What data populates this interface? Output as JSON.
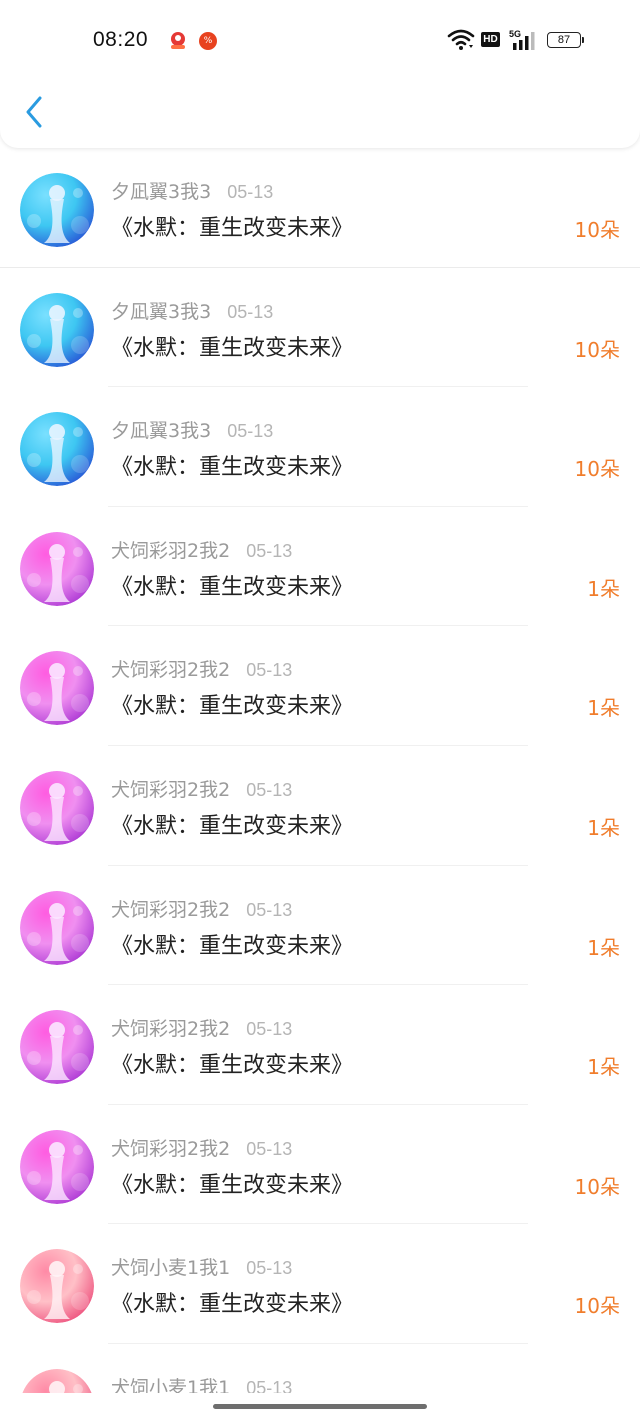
{
  "status_bar": {
    "time": "08:20",
    "network": "5G",
    "hd": "HD",
    "battery": "87",
    "icons": [
      "app-badge-icon",
      "app-badge-icon",
      "wifi-icon",
      "hd-icon",
      "signal-icon",
      "battery-icon"
    ]
  },
  "nav": {
    "back_icon": "chevron-left-icon",
    "accent_color": "#2a9be0"
  },
  "colors": {
    "amount": "#f07d2c",
    "username": "#9a9a9a",
    "title": "#222222"
  },
  "items": [
    {
      "username": "夕凪翼3我3",
      "date": "05-13",
      "title": "《水默：重生改变未来》",
      "amount": "10朵",
      "avatar_theme": "blue"
    },
    {
      "username": "夕凪翼3我3",
      "date": "05-13",
      "title": "《水默：重生改变未来》",
      "amount": "10朵",
      "avatar_theme": "blue"
    },
    {
      "username": "夕凪翼3我3",
      "date": "05-13",
      "title": "《水默：重生改变未来》",
      "amount": "10朵",
      "avatar_theme": "blue"
    },
    {
      "username": "犬饲彩羽2我2",
      "date": "05-13",
      "title": "《水默：重生改变未来》",
      "amount": "1朵",
      "avatar_theme": "purple"
    },
    {
      "username": "犬饲彩羽2我2",
      "date": "05-13",
      "title": "《水默：重生改变未来》",
      "amount": "1朵",
      "avatar_theme": "purple"
    },
    {
      "username": "犬饲彩羽2我2",
      "date": "05-13",
      "title": "《水默：重生改变未来》",
      "amount": "1朵",
      "avatar_theme": "purple"
    },
    {
      "username": "犬饲彩羽2我2",
      "date": "05-13",
      "title": "《水默：重生改变未来》",
      "amount": "1朵",
      "avatar_theme": "purple"
    },
    {
      "username": "犬饲彩羽2我2",
      "date": "05-13",
      "title": "《水默：重生改变未来》",
      "amount": "1朵",
      "avatar_theme": "purple"
    },
    {
      "username": "犬饲彩羽2我2",
      "date": "05-13",
      "title": "《水默：重生改变未来》",
      "amount": "10朵",
      "avatar_theme": "purple"
    },
    {
      "username": "犬饲小麦1我1",
      "date": "05-13",
      "title": "《水默：重生改变未来》",
      "amount": "10朵",
      "avatar_theme": "pink"
    },
    {
      "username": "犬饲小麦1我1",
      "date": "05-13",
      "title": "",
      "amount": "",
      "avatar_theme": "pink"
    }
  ]
}
